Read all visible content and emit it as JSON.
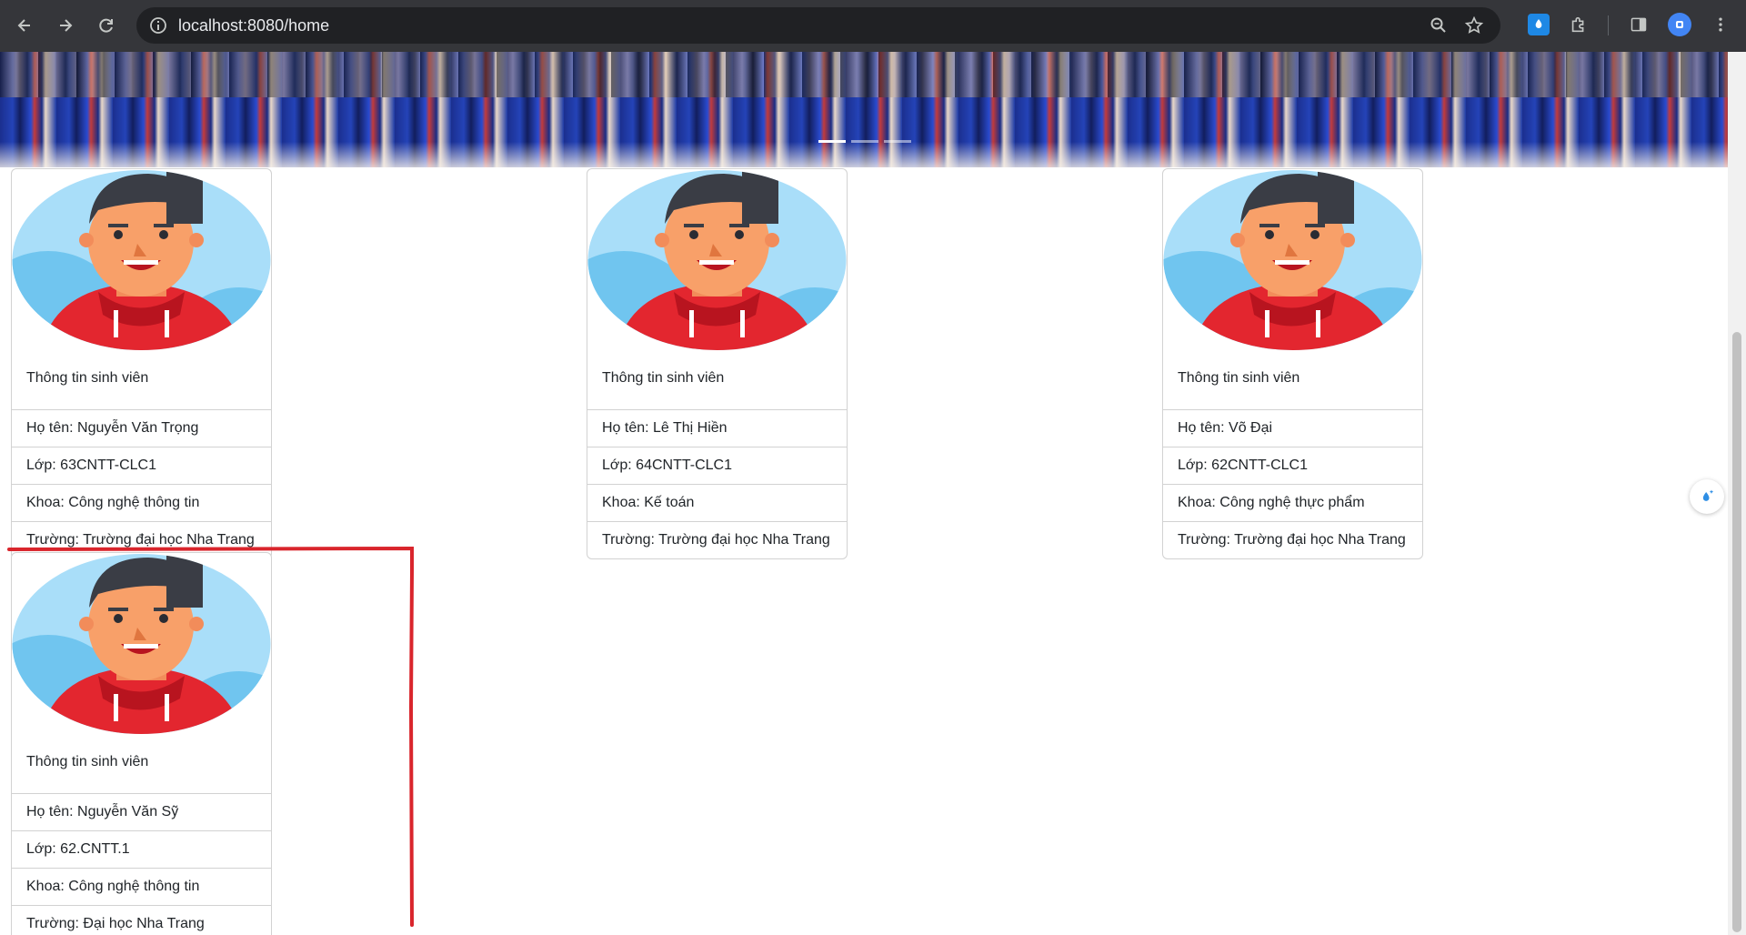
{
  "browser": {
    "url": "localhost:8080/home",
    "icons": [
      "back-icon",
      "forward-icon",
      "reload-icon",
      "info-icon",
      "zoom-icon",
      "star-icon",
      "extension-drop-icon",
      "puzzle-icon",
      "side-panel-icon",
      "profile-icon",
      "menu-icon"
    ]
  },
  "banner": {
    "indicator_count": 3,
    "active_indicator": 1
  },
  "card_heading": "Thông tin sinh viên",
  "students": [
    {
      "ten": "Họ tên: Nguyễn Văn Trọng",
      "lop": "Lớp: 63CNTT-CLC1",
      "khoa": "Khoa: Công nghệ thông tin",
      "truong": "Trường: Trường đại học Nha Trang"
    },
    {
      "ten": "Họ tên: Lê Thị Hiền",
      "lop": "Lớp: 64CNTT-CLC1",
      "khoa": "Khoa: Kế toán",
      "truong": "Trường: Trường đại học Nha Trang"
    },
    {
      "ten": "Họ tên: Võ Đại",
      "lop": "Lớp: 62CNTT-CLC1",
      "khoa": "Khoa: Công nghệ thực phẩm",
      "truong": "Trường: Trường đại học Nha Trang"
    },
    {
      "ten": "Họ tên: Nguyễn Văn Sỹ",
      "lop": "Lớp: 62.CNTT.1",
      "khoa": "Khoa: Công nghệ thông tin",
      "truong": "Trường: Đại học Nha Trang"
    }
  ],
  "colors": {
    "chrome": "#35363a",
    "omnibox": "#202124",
    "annotation": "#d9252c",
    "hoodie": "#e3262f",
    "avatar_bg": "#a9def9"
  }
}
